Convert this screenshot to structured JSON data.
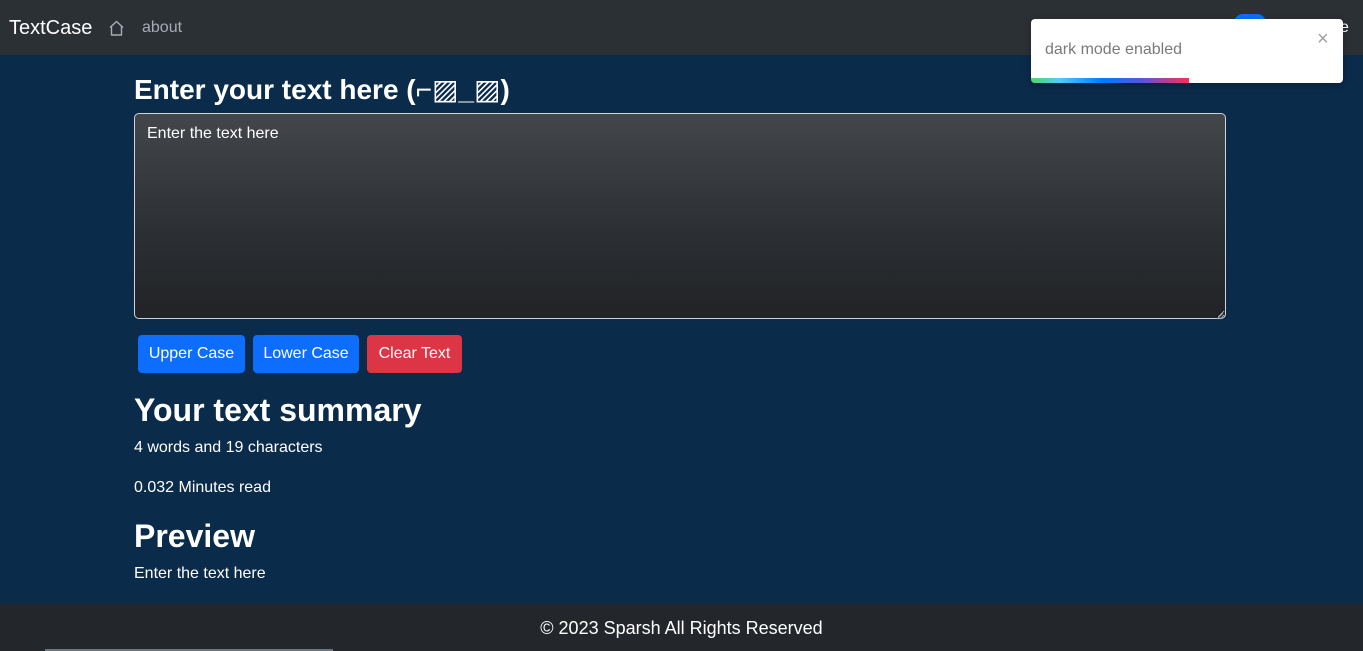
{
  "navbar": {
    "brand": "TextCase",
    "home_icon": "home-icon",
    "about_label": "about",
    "toggle_label": "e"
  },
  "toast": {
    "message": "dark mode enabled",
    "close_label": "×"
  },
  "form": {
    "heading": "Enter your text here (⌐▨_▨)",
    "textarea_value": "Enter the text here",
    "buttons": {
      "upper": "Upper Case",
      "lower": "Lower Case",
      "clear": "Clear Text"
    }
  },
  "summary": {
    "heading": "Your text summary",
    "counts": "4 words and 19 characters",
    "read_time": "0.032 Minutes read"
  },
  "preview": {
    "heading": "Preview",
    "text": "Enter the text here"
  },
  "footer": {
    "text": "© 2023 Sparsh All Rights Reserved"
  },
  "colors": {
    "page_bg": "#0a2b4a",
    "navbar_bg": "#2b3035",
    "primary": "#0d6efd",
    "danger": "#dc3545",
    "footer_bg": "#23272b"
  }
}
